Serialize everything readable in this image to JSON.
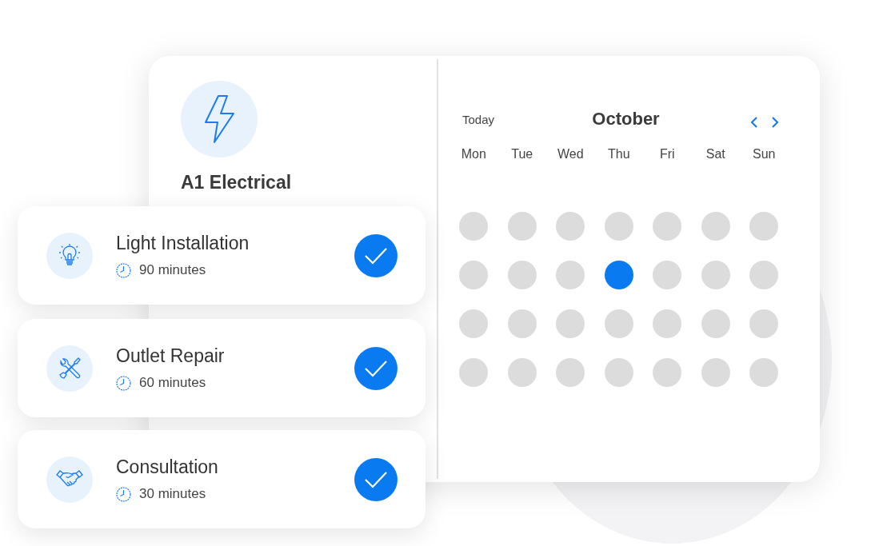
{
  "business": {
    "name": "A1 Electrical"
  },
  "services": [
    {
      "kind": "bulb",
      "name": "Light Installation",
      "duration": "90 minutes",
      "selected": true
    },
    {
      "kind": "tools",
      "name": "Outlet Repair",
      "duration": "60 minutes",
      "selected": true
    },
    {
      "kind": "handshake",
      "name": "Consultation",
      "duration": "30 minutes",
      "selected": true
    }
  ],
  "calendar": {
    "today_label": "Today",
    "month": "October",
    "weekdays": [
      "Mon",
      "Tue",
      "Wed",
      "Thu",
      "Fri",
      "Sat",
      "Sun"
    ],
    "weeks": [
      [
        {
          "selected": false
        },
        {
          "selected": false
        },
        {
          "selected": false
        },
        {
          "selected": false
        },
        {
          "selected": false
        },
        {
          "selected": false
        },
        {
          "selected": false
        }
      ],
      [
        {
          "selected": false
        },
        {
          "selected": false
        },
        {
          "selected": false
        },
        {
          "selected": true
        },
        {
          "selected": false
        },
        {
          "selected": false
        },
        {
          "selected": false
        }
      ],
      [
        {
          "selected": false
        },
        {
          "selected": false
        },
        {
          "selected": false
        },
        {
          "selected": false
        },
        {
          "selected": false
        },
        {
          "selected": false
        },
        {
          "selected": false
        }
      ],
      [
        {
          "selected": false
        },
        {
          "selected": false
        },
        {
          "selected": false
        },
        {
          "selected": false
        },
        {
          "selected": false
        },
        {
          "selected": false
        },
        {
          "selected": false
        }
      ]
    ]
  }
}
